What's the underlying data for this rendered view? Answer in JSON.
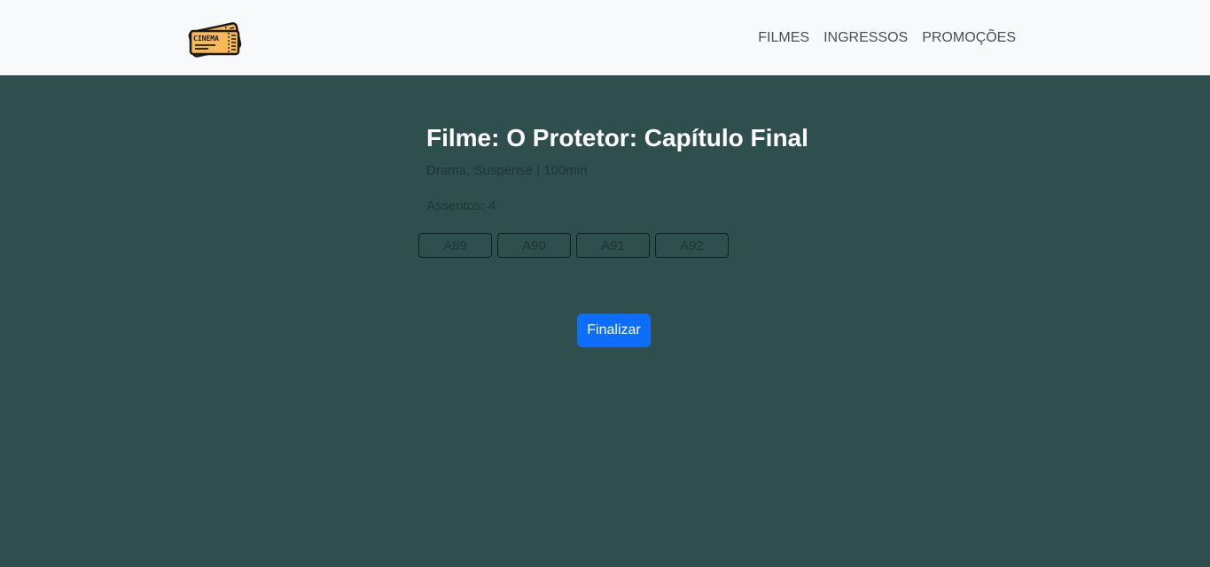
{
  "header": {
    "logo_text": "CINEMA",
    "brand_color": "#f7b858",
    "nav": [
      {
        "label": "FILMES"
      },
      {
        "label": "INGRESSOS"
      },
      {
        "label": "PROMOÇÕES"
      }
    ]
  },
  "main": {
    "title": "Filme: O Protetor: Capítulo Final",
    "meta": "Drama, Suspense | 100min",
    "seats_label": "Assentos: 4",
    "seats": [
      "A89",
      "A90",
      "A91",
      "A92"
    ],
    "finish_label": "Finalizar"
  },
  "colors": {
    "background": "#2f4f4f",
    "navbar": "#f8f9fa",
    "primary_button": "#0d6efd"
  }
}
